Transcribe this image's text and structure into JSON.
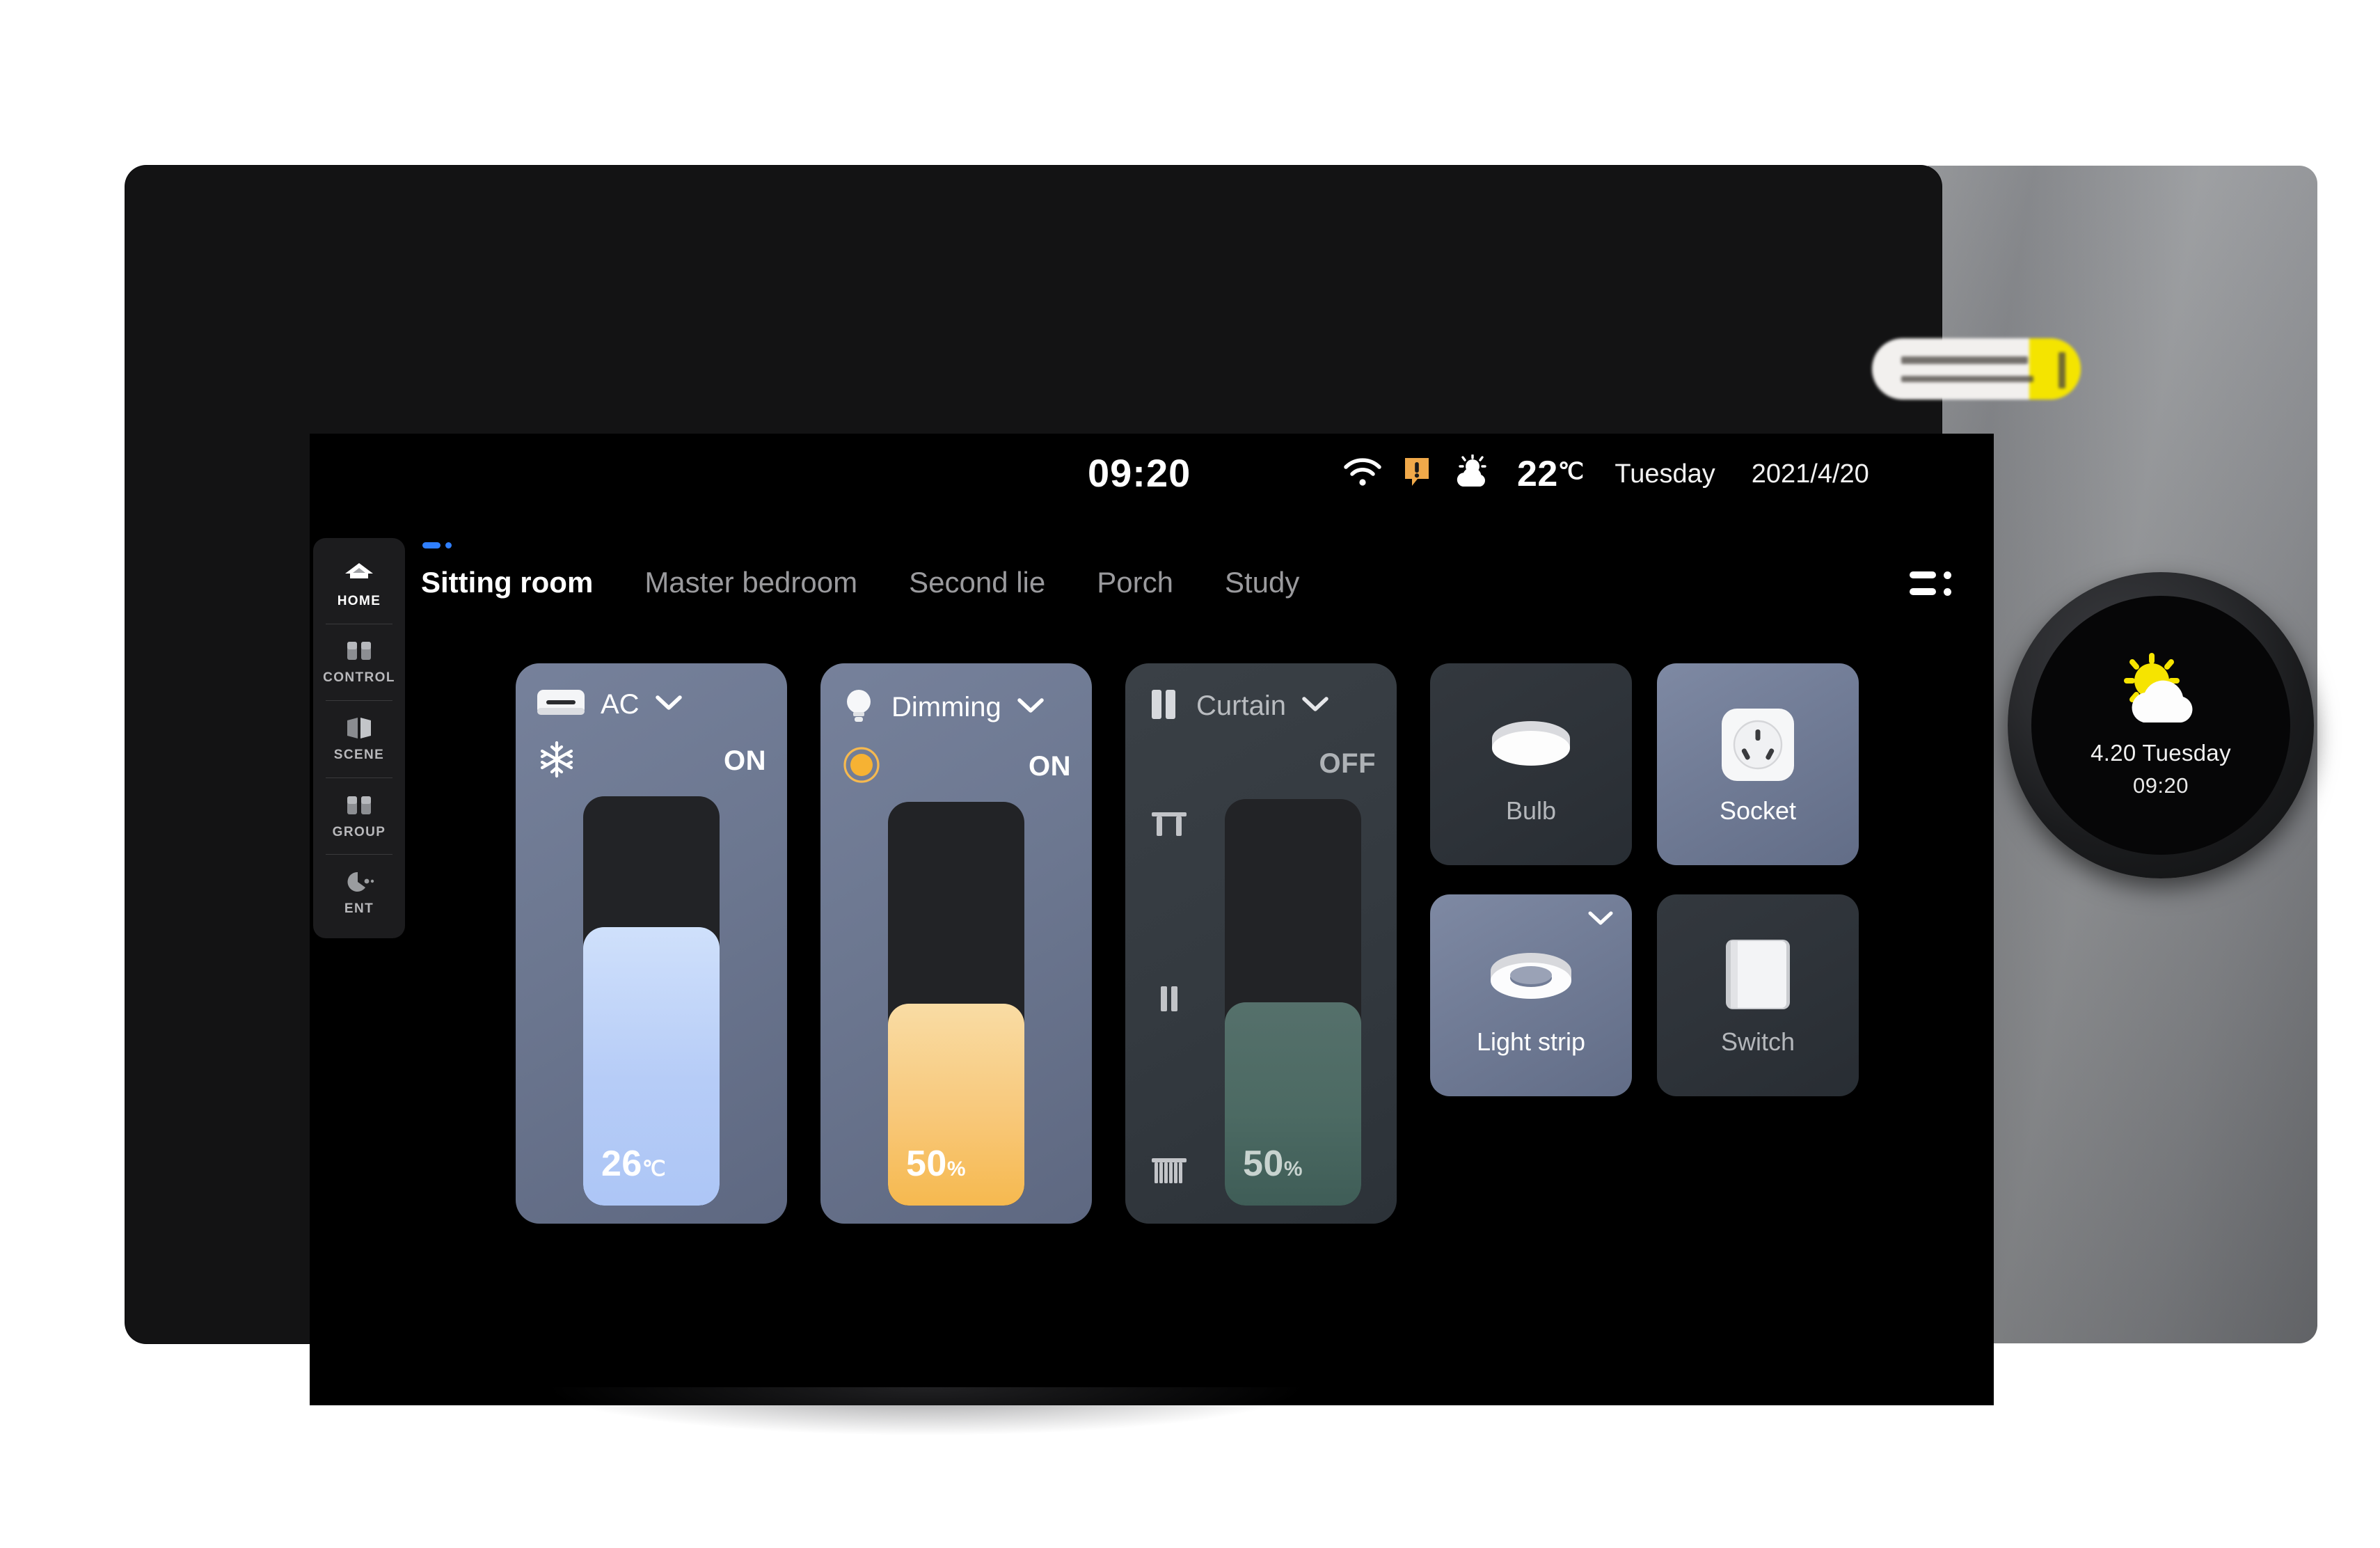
{
  "statusbar": {
    "clock": "09:20",
    "wifi_icon": "wifi-icon",
    "alert_icon": "alert-icon",
    "weather_icon": "partly-cloudy-icon",
    "temperature": "22",
    "temperature_unit": "℃",
    "weekday": "Tuesday",
    "date": "2021/4/20"
  },
  "sidebar": {
    "items": [
      {
        "label": "HOME",
        "icon": "home-icon",
        "active": true
      },
      {
        "label": "CONTROL",
        "icon": "control-icon",
        "active": false
      },
      {
        "label": "SCENE",
        "icon": "scene-icon",
        "active": false
      },
      {
        "label": "GROUP",
        "icon": "group-icon",
        "active": false
      },
      {
        "label": "ENT",
        "icon": "ent-icon",
        "active": false
      }
    ]
  },
  "tabs": {
    "items": [
      {
        "label": "Sitting room",
        "active": true
      },
      {
        "label": "Master bedroom",
        "active": false
      },
      {
        "label": "Second lie",
        "active": false
      },
      {
        "label": "Porch",
        "active": false
      },
      {
        "label": "Study",
        "active": false
      }
    ],
    "menu_icon": "list-menu-icon"
  },
  "cards": [
    {
      "title": "AC",
      "icon": "air-conditioner-icon",
      "chevron_icon": "chevron-down-icon",
      "mode_icon": "snowflake-icon",
      "state": "ON",
      "power_on": true,
      "value": "26",
      "unit": "℃",
      "fill_percent": 68,
      "fill_color": "#b6ccf7"
    },
    {
      "title": "Dimming",
      "icon": "bulb-icon",
      "chevron_icon": "chevron-down-icon",
      "mode_icon": "brightness-icon",
      "state": "ON",
      "power_on": true,
      "value": "50",
      "unit": "%",
      "fill_percent": 50,
      "fill_color": "#f6b94f"
    },
    {
      "title": "Curtain",
      "icon": "curtain-icon",
      "chevron_icon": "chevron-down-icon",
      "state": "OFF",
      "power_on": false,
      "value": "50",
      "unit": "%",
      "fill_percent": 50,
      "fill_color": "#4c6a63",
      "side_icons": [
        "curtain-open-icon",
        "curtain-pause-icon",
        "curtain-closed-icon"
      ]
    }
  ],
  "tiles": [
    {
      "label": "Bulb",
      "icon": "ceiling-light-icon",
      "power_on": false,
      "chevron": false
    },
    {
      "label": "Socket",
      "icon": "power-socket-icon",
      "power_on": true,
      "chevron": false
    },
    {
      "label": "Light strip",
      "icon": "ring-light-icon",
      "power_on": true,
      "chevron": true,
      "chevron_icon": "chevron-down-icon"
    },
    {
      "label": "Switch",
      "icon": "wall-switch-icon",
      "power_on": false,
      "chevron": false
    }
  ],
  "knob": {
    "weather_icon": "partly-cloudy-icon",
    "date": "4.20 Tuesday",
    "time": "09:20"
  },
  "colors": {
    "accent_blue": "#2f7fff",
    "card_on": "#6c7790",
    "card_off": "#343a40",
    "fill_blue": "#b6ccf7",
    "fill_orange": "#f6b94f",
    "fill_green": "#4c6a63",
    "alert_orange": "#f0a94a",
    "screen_bg": "#000000"
  }
}
